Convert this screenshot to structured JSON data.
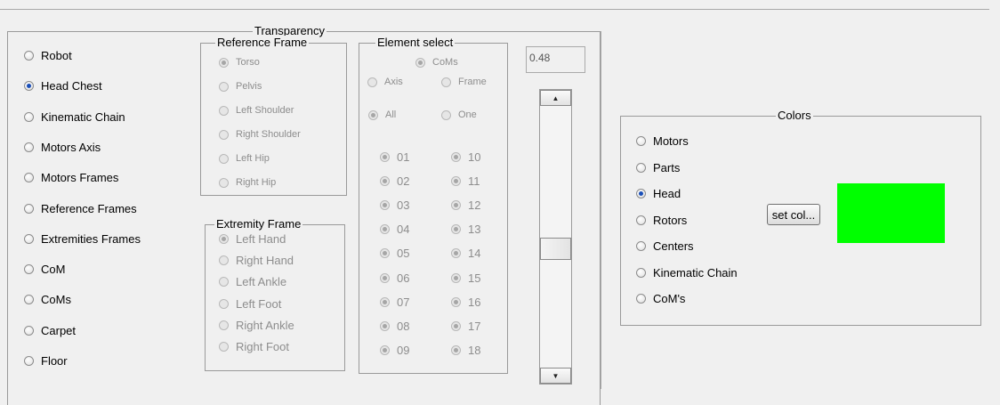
{
  "transparency": {
    "title": "Transparency",
    "value": "0.48",
    "slider_level": 0.55
  },
  "view_options": [
    {
      "label": "Robot",
      "checked": false
    },
    {
      "label": "Head Chest",
      "checked": true
    },
    {
      "label": "Kinematic Chain",
      "checked": false
    },
    {
      "label": "Motors Axis",
      "checked": false
    },
    {
      "label": "Motors Frames",
      "checked": false
    },
    {
      "label": "Reference Frames",
      "checked": false
    },
    {
      "label": "Extremities Frames",
      "checked": false
    },
    {
      "label": "CoM",
      "checked": false
    },
    {
      "label": "CoMs",
      "checked": false
    },
    {
      "label": "Carpet",
      "checked": false
    },
    {
      "label": "Floor",
      "checked": false
    }
  ],
  "reference_frame": {
    "title": "Reference Frame",
    "options": [
      {
        "label": "Torso",
        "checked": true
      },
      {
        "label": "Pelvis",
        "checked": false
      },
      {
        "label": "Left Shoulder",
        "checked": false
      },
      {
        "label": "Right Shoulder",
        "checked": false
      },
      {
        "label": "Left Hip",
        "checked": false
      },
      {
        "label": "Right Hip",
        "checked": false
      }
    ]
  },
  "extremity_frame": {
    "title": "Extremity Frame",
    "options": [
      {
        "label": "Left Hand",
        "checked": true
      },
      {
        "label": "Right Hand",
        "checked": false
      },
      {
        "label": "Left Ankle",
        "checked": false
      },
      {
        "label": "Left Foot",
        "checked": false
      },
      {
        "label": "Right Ankle",
        "checked": false
      },
      {
        "label": "Right Foot",
        "checked": false
      }
    ]
  },
  "element_select": {
    "title": "Element select",
    "coms": {
      "label": "CoMs",
      "checked": true
    },
    "axis": {
      "label": "Axis",
      "checked": false
    },
    "frame": {
      "label": "Frame",
      "checked": false
    },
    "all": {
      "label": "All",
      "checked": true
    },
    "one": {
      "label": "One",
      "checked": false
    },
    "left_column": [
      "01",
      "02",
      "03",
      "04",
      "05",
      "06",
      "07",
      "08",
      "09"
    ],
    "right_column": [
      "10",
      "11",
      "12",
      "13",
      "14",
      "15",
      "16",
      "17",
      "18"
    ]
  },
  "colors": {
    "title": "Colors",
    "options": [
      {
        "label": "Motors",
        "checked": false
      },
      {
        "label": "Parts",
        "checked": false
      },
      {
        "label": "Head",
        "checked": true
      },
      {
        "label": "Rotors",
        "checked": false
      },
      {
        "label": "Centers",
        "checked": false
      },
      {
        "label": "Kinematic Chain",
        "checked": false
      },
      {
        "label": "CoM's",
        "checked": false
      }
    ],
    "set_button": "set col...",
    "swatch_color": "#00ff00"
  }
}
